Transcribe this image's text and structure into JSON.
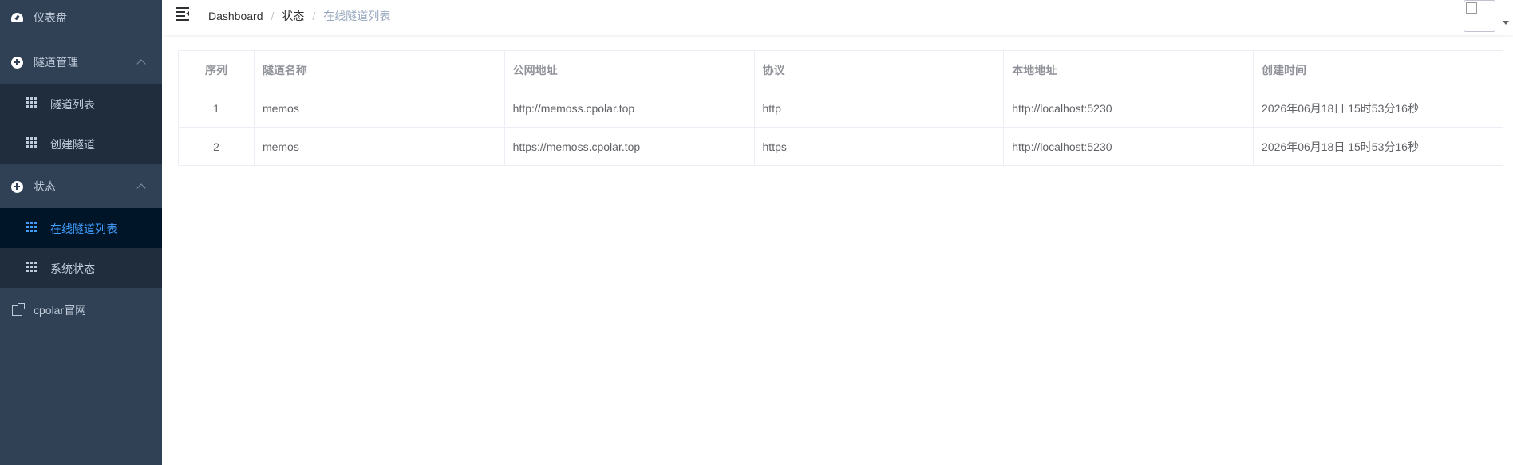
{
  "sidebar": {
    "items": [
      {
        "label": "仪表盘",
        "icon": "dashboard-gauge-icon"
      },
      {
        "label": "隧道管理",
        "icon": "circle-plus-icon",
        "expanded": true,
        "children": [
          {
            "label": "隧道列表",
            "icon": "grid-icon"
          },
          {
            "label": "创建隧道",
            "icon": "grid-icon"
          }
        ]
      },
      {
        "label": "状态",
        "icon": "circle-plus-icon",
        "expanded": true,
        "children": [
          {
            "label": "在线隧道列表",
            "icon": "grid-icon",
            "active": true
          },
          {
            "label": "系统状态",
            "icon": "grid-icon"
          }
        ]
      },
      {
        "label": "cpolar官网",
        "icon": "external-link-icon"
      }
    ]
  },
  "navbar": {
    "breadcrumb": [
      "Dashboard",
      "状态",
      "在线隧道列表"
    ],
    "breadcrumb_separator": "/"
  },
  "table": {
    "columns": [
      "序列",
      "隧道名称",
      "公网地址",
      "协议",
      "本地地址",
      "创建时间"
    ],
    "rows": [
      [
        "1",
        "memos",
        "http://memoss.cpolar.top",
        "http",
        "http://localhost:5230",
        "2026年06月18日 15时53分16秒"
      ],
      [
        "2",
        "memos",
        "https://memoss.cpolar.top",
        "https",
        "http://localhost:5230",
        "2026年06月18日 15时53分16秒"
      ]
    ]
  },
  "colors": {
    "sidebar_bg": "#304156",
    "submenu_bg": "#1f2d3d",
    "active_bg": "#001528",
    "active_text": "#409eff",
    "menu_text": "#bfcbd9"
  }
}
